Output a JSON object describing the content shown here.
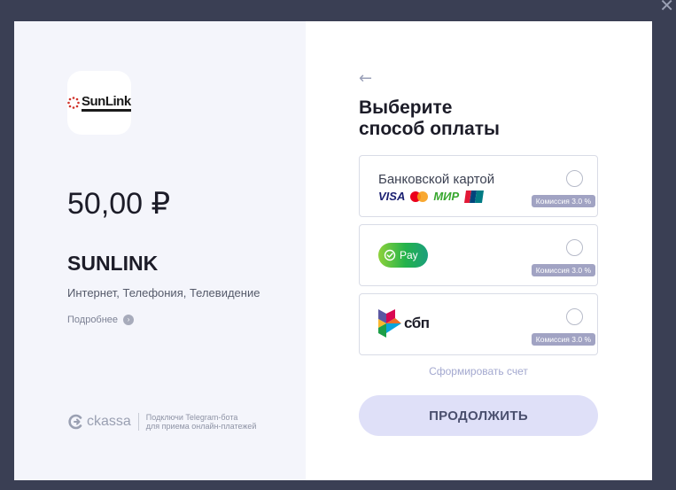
{
  "window": {
    "close_glyph": "✕"
  },
  "merchant": {
    "logo_text": "SunLink",
    "amount": "50,00 ₽",
    "name": "SUNLINK",
    "description": "Интернет, Телефония, Телевидение",
    "more_link": "Подробнее"
  },
  "footer": {
    "brand": "ckassa",
    "tagline_line1": "Подключи Telegram-бота",
    "tagline_line2": "для приема онлайн-платежей"
  },
  "payment": {
    "back_glyph": "←",
    "title_line1": "Выберите",
    "title_line2": "способ оплаты",
    "options": [
      {
        "label": "Банковской картой",
        "commission": "Комиссия 3.0 %",
        "logos": [
          "VISA",
          "mastercard-icon",
          "МИР",
          "unionpay-icon"
        ]
      },
      {
        "label": "Pay",
        "commission": "Комиссия 3.0 %"
      },
      {
        "label": "сбп",
        "commission": "Комиссия 3.0 %"
      }
    ],
    "invoice_link": "Сформировать счет",
    "continue_label": "ПРОДОЛЖИТЬ"
  },
  "colors": {
    "backdrop": "#3a3f54",
    "left_panel": "#f4f5fb",
    "commission_badge": "#a1a3c3",
    "continue_button": "#dfe0f8",
    "invoice_link": "#a3a8cf"
  }
}
